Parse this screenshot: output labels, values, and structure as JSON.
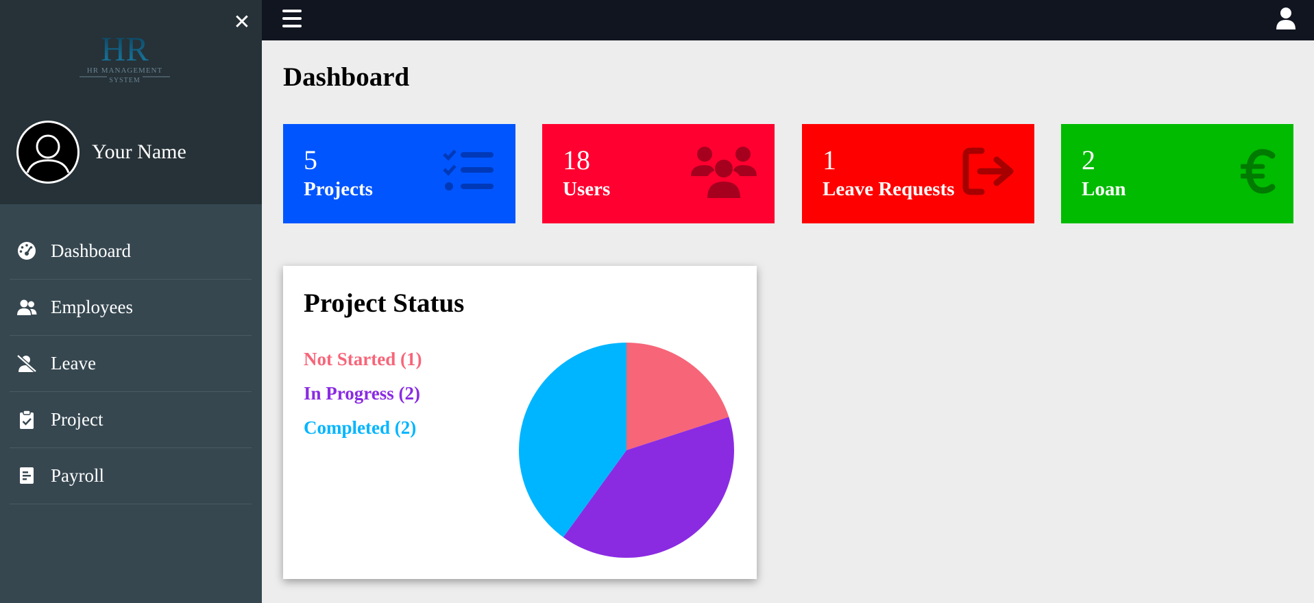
{
  "sidebar": {
    "logo": {
      "mark": "HR",
      "line1": "HR MANAGEMENT",
      "line2": "SYSTEM"
    },
    "user_name": "Your Name",
    "items": [
      {
        "label": "Dashboard",
        "icon": "dashboard-gauge-icon"
      },
      {
        "label": "Employees",
        "icon": "users-icon"
      },
      {
        "label": "Leave",
        "icon": "user-slash-icon"
      },
      {
        "label": "Project",
        "icon": "clipboard-check-icon"
      },
      {
        "label": "Payroll",
        "icon": "receipt-icon"
      }
    ],
    "close_icon": "close-icon"
  },
  "topbar": {
    "menu_icon": "hamburger-menu-icon",
    "user_icon": "user-icon"
  },
  "page": {
    "title": "Dashboard"
  },
  "cards": [
    {
      "count": "5",
      "label": "Projects",
      "icon": "task-list-icon",
      "color": "#0055ff",
      "icon_color": "#0039b8"
    },
    {
      "count": "18",
      "label": "Users",
      "icon": "users-group-icon",
      "color": "#ff0030",
      "icon_color": "#a6001f"
    },
    {
      "count": "1",
      "label": "Leave Requests",
      "icon": "sign-out-icon",
      "color": "#ff0000",
      "icon_color": "#a60000"
    },
    {
      "count": "2",
      "label": "Loan",
      "icon": "euro-icon",
      "color": "#00bb00",
      "icon_color": "#007a00"
    }
  ],
  "project_status": {
    "title": "Project Status",
    "legend": [
      {
        "label": "Not Started (1)",
        "color": "#f76579"
      },
      {
        "label": "In Progress (2)",
        "color": "#8a2be2"
      },
      {
        "label": "Completed (2)",
        "color": "#00b5ff"
      }
    ]
  },
  "chart_data": {
    "type": "pie",
    "title": "",
    "categories": [
      "Not Started",
      "In Progress",
      "Completed"
    ],
    "values": [
      1,
      2,
      2
    ],
    "colors": [
      "#f76579",
      "#8a2be2",
      "#00b5ff"
    ]
  }
}
